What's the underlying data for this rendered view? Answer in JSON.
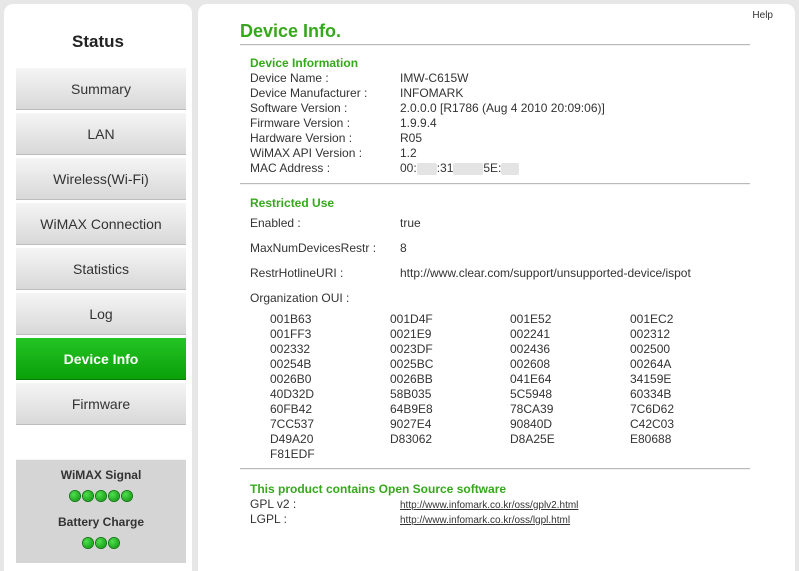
{
  "sidebar": {
    "title": "Status",
    "items": [
      {
        "label": "Summary",
        "active": false
      },
      {
        "label": "LAN",
        "active": false
      },
      {
        "label": "Wireless(Wi-Fi)",
        "active": false
      },
      {
        "label": "WiMAX Connection",
        "active": false
      },
      {
        "label": "Statistics",
        "active": false
      },
      {
        "label": "Log",
        "active": false
      },
      {
        "label": "Device Info",
        "active": true
      },
      {
        "label": "Firmware",
        "active": false
      }
    ],
    "signal": {
      "label": "WiMAX Signal",
      "dots": 5
    },
    "battery": {
      "label": "Battery Charge",
      "dots": 3
    }
  },
  "main": {
    "help": "Help",
    "title": "Device Info.",
    "device_info": {
      "heading": "Device Information",
      "rows": [
        {
          "label": "Device Name :",
          "value": "IMW-C615W"
        },
        {
          "label": "Device Manufacturer :",
          "value": "INFOMARK"
        },
        {
          "label": "Software Version :",
          "value": "2.0.0.0 [R1786 (Aug 4 2010 20:09:06)]"
        },
        {
          "label": "Firmware Version :",
          "value": "1.9.9.4"
        },
        {
          "label": "Hardware Version :",
          "value": "R05"
        },
        {
          "label": "WiMAX API Version :",
          "value": "1.2"
        }
      ],
      "mac_label": "MAC Address :",
      "mac_parts": [
        "00:",
        ":31",
        "5E:"
      ]
    },
    "restricted": {
      "heading": "Restricted Use",
      "enabled_label": "Enabled :",
      "enabled_value": "true",
      "max_label": "MaxNumDevicesRestr :",
      "max_value": "8",
      "hotline_label": "RestrHotlineURI :",
      "hotline_value": "http://www.clear.com/support/unsupported-device/ispot",
      "oui_label": "Organization OUI :",
      "oui": [
        "001B63",
        "001D4F",
        "001E52",
        "001EC2",
        "001FF3",
        "0021E9",
        "002241",
        "002312",
        "002332",
        "0023DF",
        "002436",
        "002500",
        "00254B",
        "0025BC",
        "002608",
        "00264A",
        "0026B0",
        "0026BB",
        "041E64",
        "34159E",
        "40D32D",
        "58B035",
        "5C5948",
        "60334B",
        "60FB42",
        "64B9E8",
        "78CA39",
        "7C6D62",
        "7CC537",
        "9027E4",
        "90840D",
        "C42C03",
        "D49A20",
        "D83062",
        "D8A25E",
        "E80688",
        "F81EDF"
      ]
    },
    "open_source": {
      "heading": "This product contains Open Source software",
      "gpl_label": "GPL v2 :",
      "gpl_link": "http://www.infomark.co.kr/oss/gplv2.html",
      "lgpl_label": "LGPL :",
      "lgpl_link": "http://www.infomark.co.kr/oss/lgpl.html"
    }
  }
}
